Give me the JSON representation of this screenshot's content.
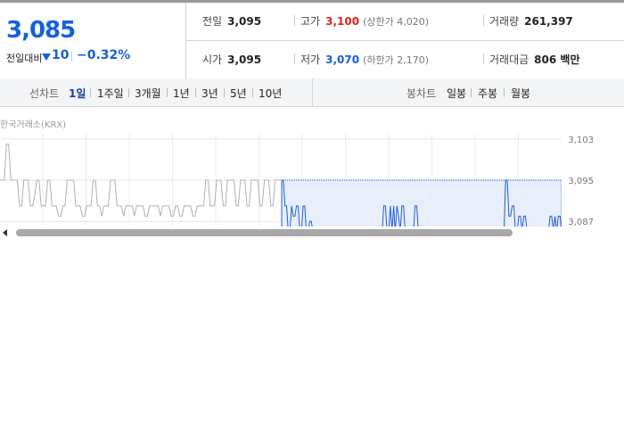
{
  "quote": {
    "price": "3,085",
    "change_label": "전일대비",
    "change_value": "10",
    "change_pct": "−0.32%",
    "stats": {
      "prev_close": {
        "label": "전일",
        "value": "3,095"
      },
      "high": {
        "label": "고가",
        "value": "3,100",
        "limit_label": "(상한가 4,020)"
      },
      "volume": {
        "label": "거래량",
        "value": "261,397"
      },
      "open": {
        "label": "시가",
        "value": "3,095"
      },
      "low": {
        "label": "저가",
        "value": "3,070",
        "limit_label": "(하한가 2,170)"
      },
      "amount": {
        "label": "거래대금",
        "value": "806 백만"
      }
    }
  },
  "tabs": {
    "line_label": "선차트",
    "line_periods": [
      "1일",
      "1주일",
      "3개월",
      "1년",
      "3년",
      "5년",
      "10년"
    ],
    "active_period": "1일",
    "candle_label": "봉차트",
    "candle_periods": [
      "일봉",
      "주봉",
      "월봉"
    ]
  },
  "chart_source": "한국거래소(KRX)",
  "chart_data": {
    "type": "line",
    "y_ticks": [
      "3,103",
      "3,095",
      "3,087"
    ],
    "ylim": [
      3086,
      3104
    ],
    "grid": true,
    "colors": {
      "past": "#b0b0b0",
      "today": "#1e5fd6",
      "today_fill": "#e8eefa"
    },
    "series": [
      {
        "values": [
          3095,
          3095,
          3095,
          3102,
          3102,
          3095,
          3095,
          3095,
          3095,
          3090,
          3090,
          3095,
          3095,
          3095,
          3090,
          3090,
          3092,
          3095,
          3095,
          3090,
          3090,
          3090,
          3095,
          3095,
          3090,
          3090,
          3090,
          3088,
          3088,
          3090,
          3090,
          3095,
          3095,
          3095,
          3095,
          3090,
          3090,
          3090,
          3088,
          3088,
          3090,
          3090,
          3090,
          3095,
          3095,
          3090,
          3090,
          3088,
          3090,
          3090,
          3090,
          3095,
          3095,
          3095,
          3090,
          3090,
          3090,
          3088,
          3090,
          3090,
          3090,
          3090,
          3088,
          3090,
          3090,
          3090,
          3090,
          3088,
          3088,
          3090,
          3090,
          3090,
          3090,
          3090,
          3088,
          3090,
          3090,
          3090,
          3090,
          3088,
          3088,
          3090,
          3090,
          3088,
          3088,
          3090,
          3090,
          3090,
          3090,
          3088,
          3088,
          3090,
          3090,
          3090,
          3090,
          3095,
          3095,
          3090,
          3090,
          3090,
          3095,
          3095,
          3095,
          3090,
          3090,
          3095,
          3095,
          3095,
          3095,
          3090,
          3090,
          3095,
          3095,
          3095,
          3090,
          3090,
          3095,
          3095,
          3095,
          3095,
          3090,
          3090,
          3095,
          3095,
          3095,
          3090,
          3090,
          3095,
          3095,
          3095,
          3095
        ]
      },
      {
        "values": [
          3095,
          3095,
          3090,
          3090,
          3085,
          3085,
          3090,
          3088,
          3088,
          3090,
          3090,
          3085,
          3085,
          3090,
          3090,
          3085,
          3085,
          3087,
          3087,
          3085,
          3085,
          3085,
          3085,
          3085,
          3085,
          3085,
          3085,
          3085,
          3085,
          3085,
          3085,
          3085,
          3085,
          3085,
          3085,
          3085,
          3085,
          3085,
          3085,
          3085,
          3085,
          3085,
          3085,
          3085,
          3085,
          3085,
          3085,
          3085,
          3085,
          3085,
          3085,
          3085,
          3085,
          3085,
          3085,
          3085,
          3085,
          3085,
          3085,
          3085,
          3085,
          3085,
          3090,
          3090,
          3085,
          3085,
          3090,
          3085,
          3090,
          3085,
          3090,
          3088,
          3085,
          3090,
          3090,
          3085,
          3085,
          3085,
          3085,
          3085,
          3085,
          3090,
          3090,
          3085,
          3085,
          3085,
          3085,
          3085,
          3085,
          3085,
          3085,
          3085,
          3085,
          3085,
          3085,
          3085,
          3085,
          3085,
          3085,
          3085,
          3085,
          3085,
          3085,
          3085,
          3085,
          3085,
          3085,
          3085,
          3085,
          3085,
          3085,
          3085,
          3085,
          3085,
          3085,
          3085,
          3085,
          3085,
          3085,
          3085,
          3085,
          3085,
          3085,
          3085,
          3085,
          3085,
          3085,
          3085,
          3085,
          3085,
          3085,
          3085,
          3085,
          3085,
          3085,
          3085,
          3095,
          3095,
          3088,
          3088,
          3090,
          3090,
          3085,
          3085,
          3088,
          3088,
          3085,
          3088,
          3088,
          3085,
          3085,
          3085,
          3085,
          3085,
          3085,
          3085,
          3085,
          3085,
          3085,
          3085,
          3085,
          3085,
          3085,
          3088,
          3088,
          3085,
          3088,
          3085,
          3088,
          3088,
          3085
        ]
      }
    ]
  }
}
